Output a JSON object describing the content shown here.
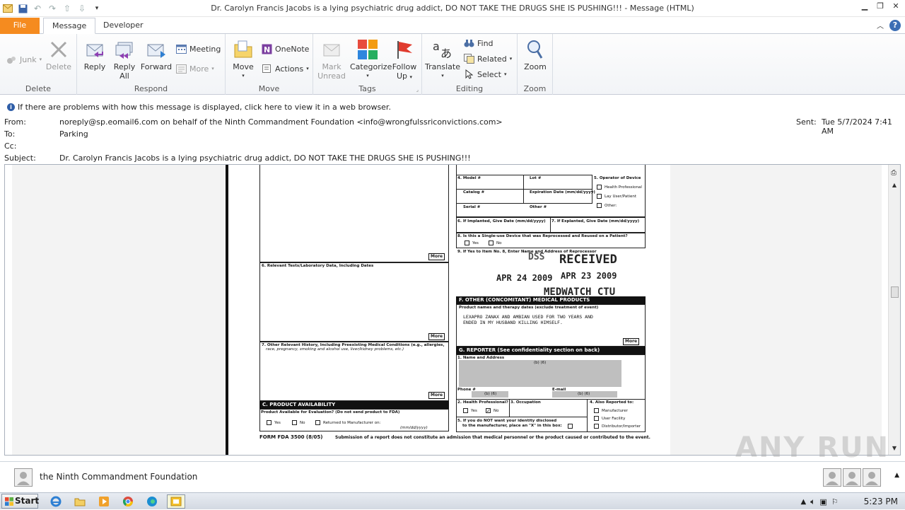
{
  "window": {
    "title": "Dr. Carolyn Francis Jacobs is a lying psychiatric drug addict, DO NOT TAKE THE DRUGS SHE IS PUSHING!!! - Message (HTML)"
  },
  "tabs": {
    "file": "File",
    "message": "Message",
    "developer": "Developer"
  },
  "ribbon": {
    "delete_group": {
      "label": "Delete",
      "junk": "Junk",
      "delete": "Delete"
    },
    "respond_group": {
      "label": "Respond",
      "reply": "Reply",
      "reply_all_1": "Reply",
      "reply_all_2": "All",
      "forward": "Forward",
      "meeting": "Meeting",
      "more": "More"
    },
    "move_group": {
      "label": "Move",
      "move": "Move",
      "onenote": "OneNote",
      "actions": "Actions"
    },
    "tags_group": {
      "label": "Tags",
      "mark_unread_1": "Mark",
      "mark_unread_2": "Unread",
      "categorize": "Categorize",
      "follow_up_1": "Follow",
      "follow_up_2": "Up"
    },
    "editing_group": {
      "label": "Editing",
      "translate": "Translate",
      "find": "Find",
      "related": "Related",
      "select": "Select"
    },
    "zoom_group": {
      "label": "Zoom",
      "zoom": "Zoom"
    }
  },
  "infobar": {
    "text": "If there are problems with how this message is displayed, click here to view it in a web browser."
  },
  "headers": {
    "from_label": "From:",
    "from_value": "noreply@sp.eomail6.com on behalf of the Ninth Commandment Foundation <info@wrongfulssriconvictions.com>",
    "to_label": "To:",
    "to_value": "Parking",
    "cc_label": "Cc:",
    "subject_label": "Subject:",
    "subject_value": "Dr. Carolyn Francis Jacobs is a lying psychiatric drug addict, DO NOT TAKE THE DRUGS SHE IS PUSHING!!!",
    "sent_label": "Sent:",
    "sent_value": "Tue 5/7/2024 7:41 AM"
  },
  "form": {
    "more": "More",
    "relevant_tests": "6. Relevant Tests/Laboratory Data, Including Dates",
    "other_history_1": "7. Other Relevant History, Including Preexisting Medical Conditions (e.g., allergies,",
    "other_history_2": "race, pregnancy, smoking and alcohol use, liver/kidney problems, etc.)",
    "product_availability": "C. PRODUCT AVAILABILITY",
    "product_available": "Product Available for Evaluation? (Do not send product to FDA)",
    "yes": "Yes",
    "no": "No",
    "returned": "Returned to Manufacturer on:",
    "date_format": "(mm/dd/yyyy)",
    "form_no": "FORM FDA 3500 (8/05)",
    "disclaimer": "Submission of a report does not constitute an admission that medical personnel or the product caused or contributed to the event.",
    "model": "4. Model #",
    "lot": "Lot #",
    "operator": "5. Operator of Device",
    "health_prof": "Health Professional",
    "lay_user": "Lay User/Patient",
    "other": "Other:",
    "catalog": "Catalog #",
    "expiration": "Expiration Date (mm/dd/yyyy)",
    "serial": "Serial #",
    "other_num": "Other #",
    "implanted": "6. If Implanted, Give Date (mm/dd/yyyy)",
    "explanted": "7. If Explanted, Give Date (mm/dd/yyyy)",
    "single_use": "8. Is this a Single-use Device that was Reprocessed and Reused on a Patient?",
    "reprocessor": "9. If Yes to Item No. 8, Enter Name and Address of Reprocessor",
    "stamp_received": "RECEIVED",
    "stamp_date1": "APR 24 2009",
    "stamp_date2": "APR 23 2009",
    "stamp_medwatch": "MEDWATCH CTU",
    "stamp_dss": "DSS",
    "concomitant": "F. OTHER (CONCOMITANT) MEDICAL PRODUCTS",
    "product_names": "Product names and therapy dates (exclude treatment of event)",
    "typed_1": "LEXAPRO ZANAX AND AMBIAN USED FOR TWO YEARS AND",
    "typed_2": "ENDED IN MY HUSBAND KILLING HIMSELF.",
    "reporter": "G. REPORTER (See confidentiality section on back)",
    "name_address": "1. Name and Address",
    "redacted": "(b) (6)",
    "phone": "Phone #",
    "email": "E-mail",
    "health_professional_q": "2. Health Professional?",
    "occupation": "3. Occupation",
    "also_reported": "4. Also Reported to:",
    "manufacturer": "Manufacturer",
    "user_facility": "User Facility",
    "distributor": "Distributor/Importer",
    "identity_1": "5. If you do NOT want your identity disclosed",
    "identity_2": "to the manufacturer, place an \"X\" in this box:",
    "x_mark": "✓"
  },
  "people_pane": {
    "name": "the Ninth Commandment Foundation"
  },
  "taskbar": {
    "start": "Start",
    "clock": "5:23 PM"
  },
  "watermark": "ANY RUN"
}
